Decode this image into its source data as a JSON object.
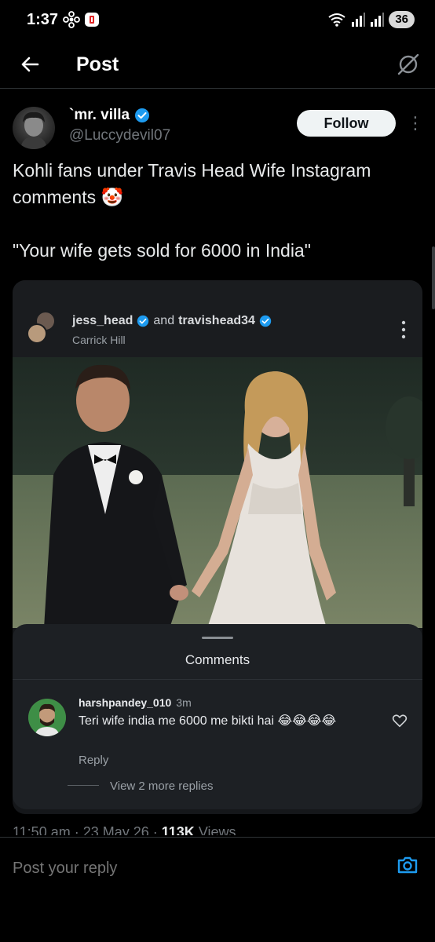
{
  "status_bar": {
    "time": "1:37",
    "battery": "36",
    "icons": [
      "pinwheel-icon",
      "app-notification-icon",
      "wifi-icon",
      "signal-icon",
      "signal-icon"
    ]
  },
  "header": {
    "title": "Post",
    "back_icon": "arrow-left-icon",
    "grok_icon": "grok-icon"
  },
  "author": {
    "name": "`mr. villa",
    "handle": "@Luccydevil07",
    "verified": true,
    "follow_label": "Follow",
    "more_icon": "more-vertical-icon"
  },
  "post": {
    "line1": "Kohli fans under Travis Head Wife Instagram comments 🤡",
    "line2": "\"Your wife gets sold for 6000 in India\""
  },
  "instagram_card": {
    "user1": "jess_head",
    "connector": "and",
    "user2": "travishead34",
    "location": "Carrick Hill",
    "comments_title": "Comments",
    "comment": {
      "username": "harshpandey_010",
      "time": "3m",
      "text": "Teri wife india me 6000 me bikti hai 😂😂😂😂",
      "reply_label": "Reply",
      "more_replies": "View 2 more replies"
    }
  },
  "meta": {
    "time": "11:50 am · 23 May 26 · ",
    "views_count": "113K",
    "views_label": " Views"
  },
  "reply_bar": {
    "placeholder": "Post your reply",
    "camera_icon": "camera-icon"
  },
  "colors": {
    "background": "#000000",
    "verified_blue": "#1d9bf0",
    "follow_bg": "#eff3f4",
    "muted": "#71767b",
    "camera_blue": "#1d9bf0"
  }
}
